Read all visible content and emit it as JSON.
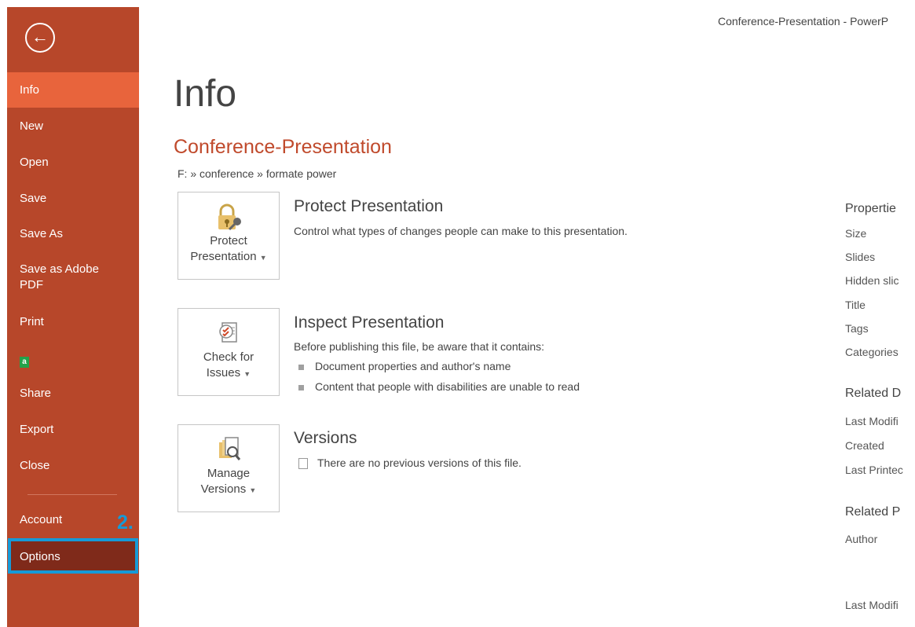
{
  "window_title": "Conference-Presentation - PowerP",
  "sidebar": {
    "back_icon": "back-arrow-icon",
    "items": [
      {
        "label": "Info"
      },
      {
        "label": "New"
      },
      {
        "label": "Open"
      },
      {
        "label": "Save"
      },
      {
        "label": "Save As"
      },
      {
        "label": "Save as Adobe PDF"
      },
      {
        "label": "Print"
      },
      {
        "label": "",
        "icon": "adobe-addin-icon"
      },
      {
        "label": "Share"
      },
      {
        "label": "Export"
      },
      {
        "label": "Close"
      },
      {
        "label": "Account"
      },
      {
        "label": "Options"
      }
    ],
    "step_marker": "2.",
    "colors": {
      "background": "#b7472a",
      "active": "#e8643c",
      "highlight_border": "#169ad7"
    }
  },
  "main": {
    "page_title": "Info",
    "document_title": "Conference-Presentation",
    "breadcrumb": "F: » conference » formate power",
    "sections": [
      {
        "tile_label_1": "Protect",
        "tile_label_2": "Presentation",
        "icon": "lock-key-icon",
        "title": "Protect Presentation",
        "description": "Control what types of changes people can make to this presentation."
      },
      {
        "tile_label_1": "Check for",
        "tile_label_2": "Issues",
        "icon": "inspect-document-icon",
        "title": "Inspect Presentation",
        "description": "Before publishing this file, be aware that it contains:",
        "bullets": [
          "Document properties and author's name",
          "Content that people with disabilities are unable to read"
        ]
      },
      {
        "tile_label_1": "Manage",
        "tile_label_2": "Versions",
        "icon": "manage-versions-icon",
        "title": "Versions",
        "description": "There are no previous versions of this file."
      }
    ]
  },
  "properties": {
    "title": "Propertie",
    "labels": [
      "Size",
      "Slides",
      "Hidden slic",
      "Title",
      "Tags",
      "Categories"
    ],
    "related_dates_title": "Related D",
    "date_labels": [
      "Last Modifi",
      "Created",
      "Last Printec"
    ],
    "related_people_title": "Related P",
    "people_labels": [
      "Author",
      "Last Modifi"
    ]
  }
}
